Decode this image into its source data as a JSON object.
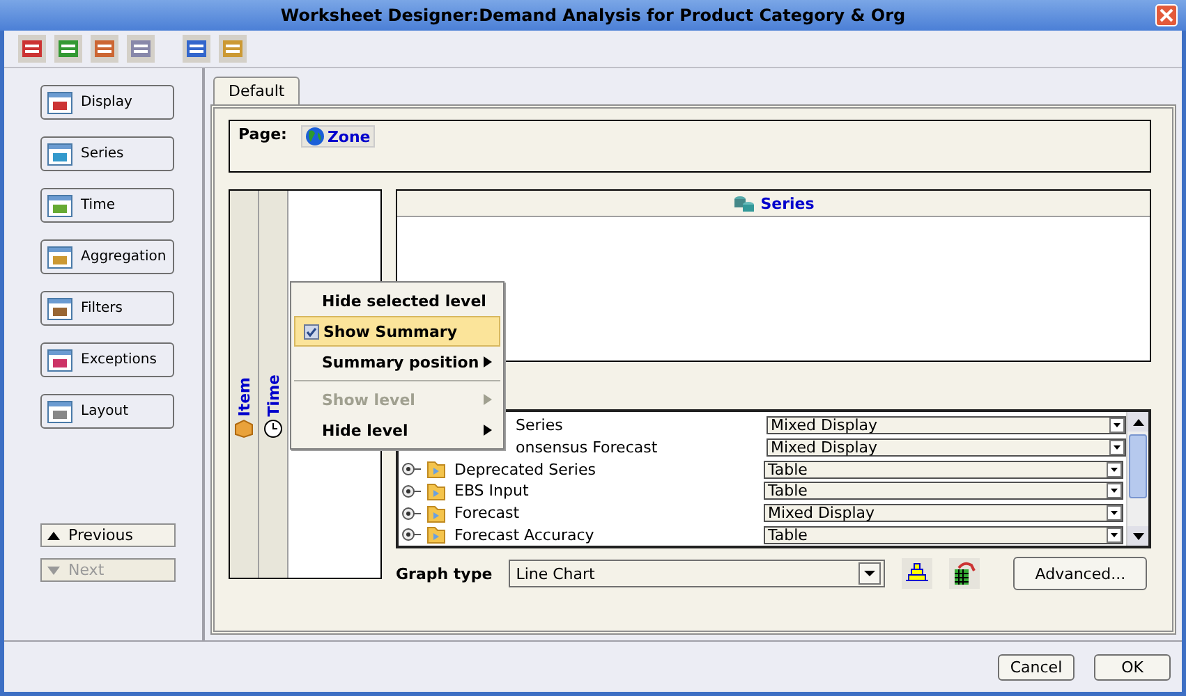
{
  "window": {
    "title": "Worksheet Designer:Demand Analysis for Product Category & Org"
  },
  "sidebar": {
    "items": [
      {
        "label": "Display",
        "selected": false
      },
      {
        "label": "Series",
        "selected": false
      },
      {
        "label": "Time",
        "selected": false
      },
      {
        "label": "Aggregation",
        "selected": false
      },
      {
        "label": "Filters",
        "selected": false
      },
      {
        "label": "Exceptions",
        "selected": false
      },
      {
        "label": "Layout",
        "selected": false
      }
    ],
    "nav": [
      {
        "label": "Previous",
        "disabled": false,
        "kind": "up"
      },
      {
        "label": "Next",
        "disabled": true,
        "kind": "down"
      }
    ]
  },
  "tabs": [
    {
      "label": "Default",
      "selected": true
    }
  ],
  "page": {
    "label": "Page:",
    "dimension": "Zone"
  },
  "axis_levels": [
    {
      "label": "Item"
    },
    {
      "label": "Time"
    }
  ],
  "series_header": "Series",
  "context_menu": [
    {
      "label": "Hide selected level",
      "kind": "item",
      "checked": false,
      "disabled": false,
      "highlighted": false,
      "submenu": false
    },
    {
      "label": "Show Summary",
      "kind": "item",
      "checked": true,
      "disabled": false,
      "highlighted": true,
      "submenu": false
    },
    {
      "label": "Summary position",
      "kind": "item",
      "checked": false,
      "disabled": false,
      "highlighted": false,
      "submenu": true
    },
    {
      "kind": "separator"
    },
    {
      "label": "Show level",
      "kind": "item",
      "checked": false,
      "disabled": true,
      "highlighted": false,
      "submenu": true
    },
    {
      "label": "Hide level",
      "kind": "item",
      "checked": false,
      "disabled": false,
      "highlighted": false,
      "submenu": true
    }
  ],
  "series_list": [
    {
      "name": "Series",
      "display": "Mixed Display"
    },
    {
      "name": "onsensus Forecast",
      "display": "Mixed Display"
    },
    {
      "name": "Deprecated Series",
      "display": "Table"
    },
    {
      "name": "EBS Input",
      "display": "Table"
    },
    {
      "name": "Forecast",
      "display": "Mixed Display"
    },
    {
      "name": "Forecast Accuracy",
      "display": "Table"
    }
  ],
  "graph_type": {
    "label": "Graph type",
    "value": "Line Chart"
  },
  "advanced_button": "Advanced...",
  "buttons": [
    "Cancel",
    "OK"
  ]
}
